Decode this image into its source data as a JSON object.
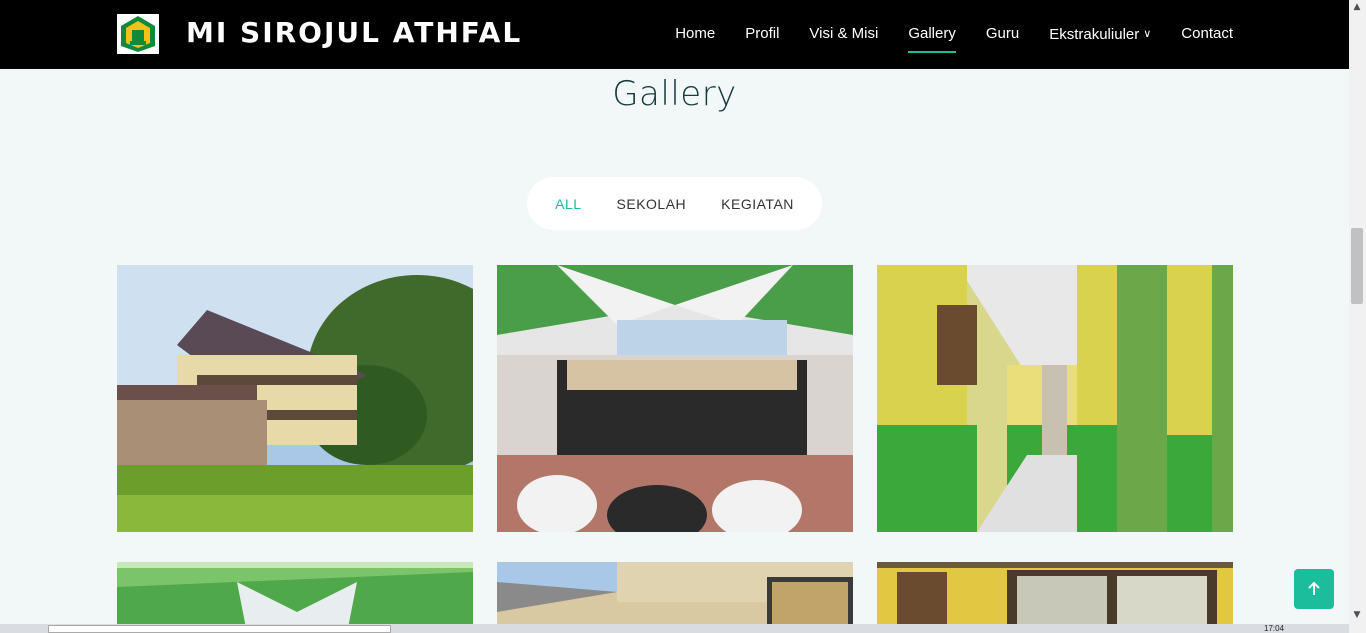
{
  "header": {
    "brand": "MI SIROJUL ATHFAL",
    "nav": [
      {
        "label": "Home"
      },
      {
        "label": "Profil"
      },
      {
        "label": "Visi & Misi"
      },
      {
        "label": "Gallery",
        "active": true
      },
      {
        "label": "Guru"
      },
      {
        "label": "Ekstrakuliuler",
        "dropdown": true
      },
      {
        "label": "Contact"
      }
    ]
  },
  "section": {
    "title": "Gallery"
  },
  "filter": {
    "items": [
      "ALL",
      "SEKOLAH",
      "KEGIATAN"
    ],
    "active": "ALL"
  },
  "gallery": {
    "tiles": [
      {
        "icon": "photo-school-building"
      },
      {
        "icon": "photo-group-event"
      },
      {
        "icon": "photo-corridor"
      },
      {
        "icon": "photo-decorated-tent"
      },
      {
        "icon": "photo-classroom-roof"
      },
      {
        "icon": "photo-classroom-window"
      }
    ]
  },
  "back_to_top": {
    "icon": "arrow-up-icon"
  },
  "taskbar": {
    "clock": "17:04"
  },
  "colors": {
    "accent": "#1bbd9c",
    "header_bg": "#000000",
    "page_bg": "#f2f8f7",
    "title": "#173b3f"
  }
}
